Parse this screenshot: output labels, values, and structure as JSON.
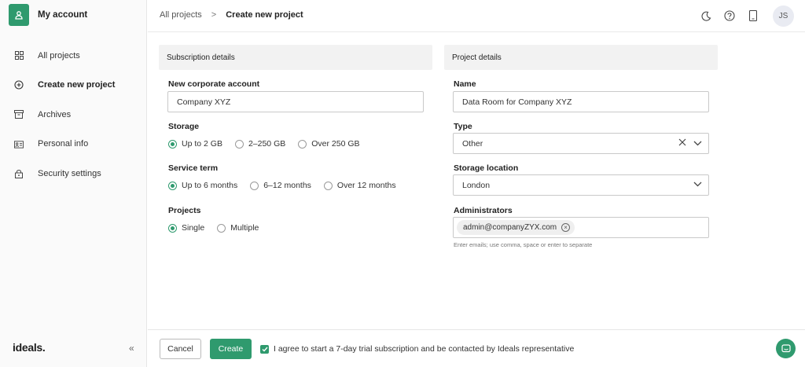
{
  "sidebar": {
    "account_label": "My account",
    "items": [
      {
        "label": "All projects",
        "icon": "grid-icon"
      },
      {
        "label": "Create new project",
        "icon": "plus-circle-icon"
      },
      {
        "label": "Archives",
        "icon": "archive-icon"
      },
      {
        "label": "Personal info",
        "icon": "id-card-icon"
      },
      {
        "label": "Security settings",
        "icon": "lock-icon"
      }
    ],
    "active_index": 1,
    "logo": "ideals.",
    "collapse": "«"
  },
  "header": {
    "breadcrumb": [
      "All projects",
      "Create new project"
    ],
    "separator": ">",
    "icons": [
      "moon-icon",
      "help-icon",
      "tablet-icon"
    ],
    "avatar": "JS"
  },
  "subscription": {
    "heading": "Subscription details",
    "corporate_account": {
      "label": "New corporate account",
      "value": "Company XYZ"
    },
    "storage": {
      "label": "Storage",
      "options": [
        "Up to 2 GB",
        "2–250 GB",
        "Over 250 GB"
      ],
      "selected": 0
    },
    "service_term": {
      "label": "Service term",
      "options": [
        "Up to 6 months",
        "6–12 months",
        "Over 12 months"
      ],
      "selected": 0
    },
    "projects": {
      "label": "Projects",
      "options": [
        "Single",
        "Multiple"
      ],
      "selected": 0
    }
  },
  "project": {
    "heading": "Project details",
    "name": {
      "label": "Name",
      "value": "Data Room for Company XYZ"
    },
    "type": {
      "label": "Type",
      "value": "Other"
    },
    "storage_location": {
      "label": "Storage location",
      "value": "London"
    },
    "administrators": {
      "label": "Administrators",
      "chips": [
        "admin@companyZYX.com"
      ],
      "hint": "Enter emails; use comma, space or enter to separate"
    }
  },
  "footer": {
    "cancel": "Cancel",
    "create": "Create",
    "agree": "I agree to start a 7-day trial subscription and be contacted by Ideals representative",
    "agree_checked": true
  },
  "colors": {
    "accent": "#2f9a6e"
  }
}
